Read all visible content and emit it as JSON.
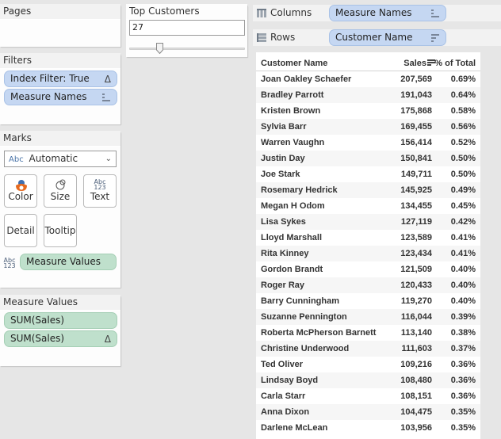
{
  "pages": {
    "title": "Pages"
  },
  "filters": {
    "title": "Filters",
    "items": [
      {
        "label": "Index Filter: True",
        "icon": "delta-icon",
        "glyph": "Δ"
      },
      {
        "label": "Measure Names",
        "icon": "discrete-bars-icon"
      }
    ]
  },
  "marks": {
    "title": "Marks",
    "mark_type_prefix": "Abc",
    "mark_type": "Automatic",
    "buttons": {
      "color": "Color",
      "size": "Size",
      "text": "Text",
      "detail": "Detail",
      "tooltip": "Tooltip"
    },
    "text_icon": {
      "line1": "Abc",
      "line2": "123"
    },
    "text_pill": "Measure Values"
  },
  "measure_values": {
    "title": "Measure Values",
    "items": [
      {
        "label": "SUM(Sales)"
      },
      {
        "label": "SUM(Sales)",
        "glyph": "Δ"
      }
    ]
  },
  "parameter": {
    "title": "Top Customers",
    "value": "27",
    "slider_fraction": 0.25
  },
  "shelves": {
    "columns": {
      "label": "Columns",
      "pill": "Measure Names"
    },
    "rows": {
      "label": "Rows",
      "pill": "Customer Name"
    }
  },
  "table": {
    "headers": {
      "name": "Customer Name",
      "sales": "Sales",
      "pct": "% of Total"
    },
    "rows": [
      {
        "name": "Joan Oakley Schaefer",
        "sales": "207,569",
        "pct": "0.69%"
      },
      {
        "name": "Bradley Parrott",
        "sales": "191,043",
        "pct": "0.64%"
      },
      {
        "name": "Kristen Brown",
        "sales": "175,868",
        "pct": "0.58%"
      },
      {
        "name": "Sylvia Barr",
        "sales": "169,455",
        "pct": "0.56%"
      },
      {
        "name": "Warren Vaughn",
        "sales": "156,414",
        "pct": "0.52%"
      },
      {
        "name": "Justin Day",
        "sales": "150,841",
        "pct": "0.50%"
      },
      {
        "name": "Joe Stark",
        "sales": "149,711",
        "pct": "0.50%"
      },
      {
        "name": "Rosemary Hedrick",
        "sales": "145,925",
        "pct": "0.49%"
      },
      {
        "name": "Megan H Odom",
        "sales": "134,455",
        "pct": "0.45%"
      },
      {
        "name": "Lisa Sykes",
        "sales": "127,119",
        "pct": "0.42%"
      },
      {
        "name": "Lloyd Marshall",
        "sales": "123,589",
        "pct": "0.41%"
      },
      {
        "name": "Rita Kinney",
        "sales": "123,434",
        "pct": "0.41%"
      },
      {
        "name": "Gordon Brandt",
        "sales": "121,509",
        "pct": "0.40%"
      },
      {
        "name": "Roger Ray",
        "sales": "120,433",
        "pct": "0.40%"
      },
      {
        "name": "Barry Cunningham",
        "sales": "119,270",
        "pct": "0.40%"
      },
      {
        "name": "Suzanne Pennington",
        "sales": "116,044",
        "pct": "0.39%"
      },
      {
        "name": "Roberta McPherson Barnett",
        "sales": "113,140",
        "pct": "0.38%"
      },
      {
        "name": "Christine Underwood",
        "sales": "111,603",
        "pct": "0.37%"
      },
      {
        "name": "Ted Oliver",
        "sales": "109,216",
        "pct": "0.36%"
      },
      {
        "name": "Lindsay Boyd",
        "sales": "108,480",
        "pct": "0.36%"
      },
      {
        "name": "Carla Starr",
        "sales": "108,151",
        "pct": "0.36%"
      },
      {
        "name": "Anna Dixon",
        "sales": "104,475",
        "pct": "0.35%"
      },
      {
        "name": "Darlene McLean",
        "sales": "103,956",
        "pct": "0.35%"
      }
    ]
  }
}
